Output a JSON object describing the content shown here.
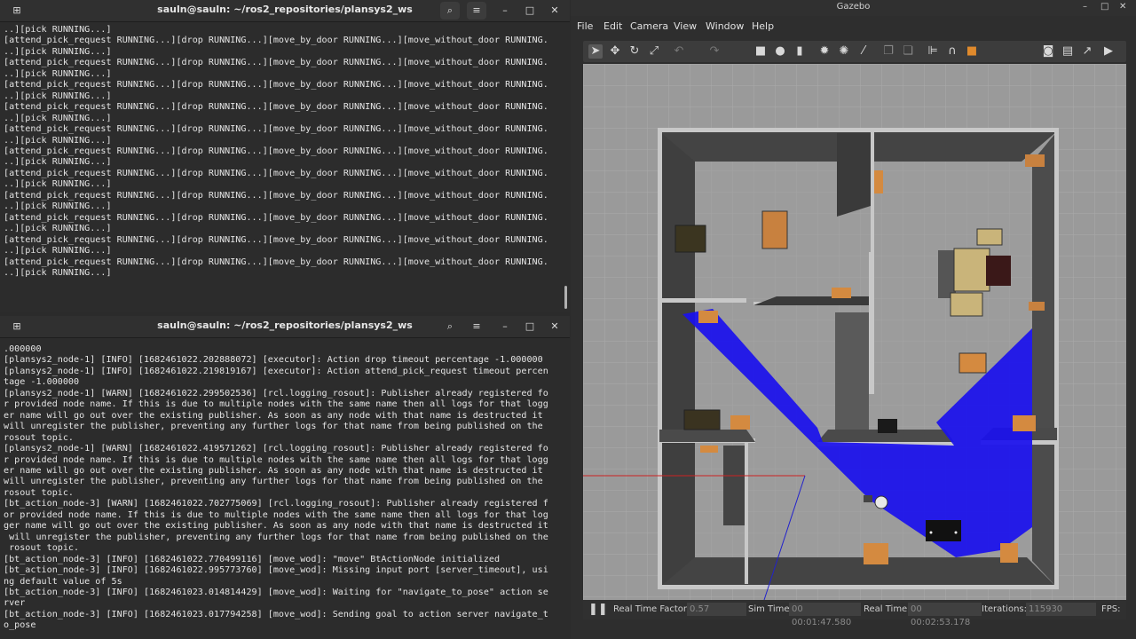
{
  "terminal_top": {
    "title": "sauln@sauln: ~/ros2_repositories/plansys2_ws",
    "lines": [
      "..][pick RUNNING...]",
      "[attend_pick_request RUNNING...][drop RUNNING...][move_by_door RUNNING...][move_without_door RUNNING.",
      "..][pick RUNNING...]",
      "[attend_pick_request RUNNING...][drop RUNNING...][move_by_door RUNNING...][move_without_door RUNNING.",
      "..][pick RUNNING...]",
      "[attend_pick_request RUNNING...][drop RUNNING...][move_by_door RUNNING...][move_without_door RUNNING.",
      "..][pick RUNNING...]",
      "[attend_pick_request RUNNING...][drop RUNNING...][move_by_door RUNNING...][move_without_door RUNNING.",
      "..][pick RUNNING...]",
      "[attend_pick_request RUNNING...][drop RUNNING...][move_by_door RUNNING...][move_without_door RUNNING.",
      "..][pick RUNNING...]",
      "[attend_pick_request RUNNING...][drop RUNNING...][move_by_door RUNNING...][move_without_door RUNNING.",
      "..][pick RUNNING...]",
      "[attend_pick_request RUNNING...][drop RUNNING...][move_by_door RUNNING...][move_without_door RUNNING.",
      "..][pick RUNNING...]",
      "[attend_pick_request RUNNING...][drop RUNNING...][move_by_door RUNNING...][move_without_door RUNNING.",
      "..][pick RUNNING...]",
      "[attend_pick_request RUNNING...][drop RUNNING...][move_by_door RUNNING...][move_without_door RUNNING.",
      "..][pick RUNNING...]",
      "[attend_pick_request RUNNING...][drop RUNNING...][move_by_door RUNNING...][move_without_door RUNNING.",
      "..][pick RUNNING...]",
      "[attend_pick_request RUNNING...][drop RUNNING...][move_by_door RUNNING...][move_without_door RUNNING.",
      "..][pick RUNNING...]"
    ]
  },
  "terminal_bottom": {
    "title": "sauln@sauln: ~/ros2_repositories/plansys2_ws",
    "lines": [
      ".000000",
      "[plansys2_node-1] [INFO] [1682461022.202888072] [executor]: Action drop timeout percentage -1.000000",
      "[plansys2_node-1] [INFO] [1682461022.219819167] [executor]: Action attend_pick_request timeout percen",
      "tage -1.000000",
      "[plansys2_node-1] [WARN] [1682461022.299502536] [rcl.logging_rosout]: Publisher already registered fo",
      "r provided node name. If this is due to multiple nodes with the same name then all logs for that logg",
      "er name will go out over the existing publisher. As soon as any node with that name is destructed it",
      "will unregister the publisher, preventing any further logs for that name from being published on the",
      "rosout topic.",
      "[plansys2_node-1] [WARN] [1682461022.419571262] [rcl.logging_rosout]: Publisher already registered fo",
      "r provided node name. If this is due to multiple nodes with the same name then all logs for that logg",
      "er name will go out over the existing publisher. As soon as any node with that name is destructed it",
      "will unregister the publisher, preventing any further logs for that name from being published on the",
      "rosout topic.",
      "[bt_action_node-3] [WARN] [1682461022.702775069] [rcl.logging_rosout]: Publisher already registered f",
      "or provided node name. If this is due to multiple nodes with the same name then all logs for that log",
      "ger name will go out over the existing publisher. As soon as any node with that name is destructed it",
      " will unregister the publisher, preventing any further logs for that name from being published on the",
      " rosout topic.",
      "[bt_action_node-3] [INFO] [1682461022.770499116] [move_wod]: \"move\" BtActionNode initialized",
      "[bt_action_node-3] [INFO] [1682461022.995773760] [move_wod]: Missing input port [server_timeout], usi",
      "ng default value of 5s",
      "[bt_action_node-3] [INFO] [1682461023.014814429] [move_wod]: Waiting for \"navigate_to_pose\" action se",
      "rver",
      "[bt_action_node-3] [INFO] [1682461023.017794258] [move_wod]: Sending goal to action server navigate_t",
      "o_pose"
    ]
  },
  "gazebo": {
    "title": "Gazebo",
    "menus": [
      "File",
      "Edit",
      "Camera",
      "View",
      "Window",
      "Help"
    ],
    "status": {
      "rtf_label": "Real Time Factor:",
      "rtf_value": "0.57",
      "sim_label": "Sim Time:",
      "sim_value": "00 00:01:47.580",
      "real_label": "Real Time:",
      "real_value": "00 00:02:53.178",
      "iter_label": "Iterations:",
      "iter_value": "115930",
      "fps_label": "FPS:"
    }
  },
  "colors": {
    "laser": "#1a10ee",
    "floor": "#9a9a9a",
    "wall_top": "#c8c8c8",
    "wall_dark": "#3f3f3f"
  }
}
